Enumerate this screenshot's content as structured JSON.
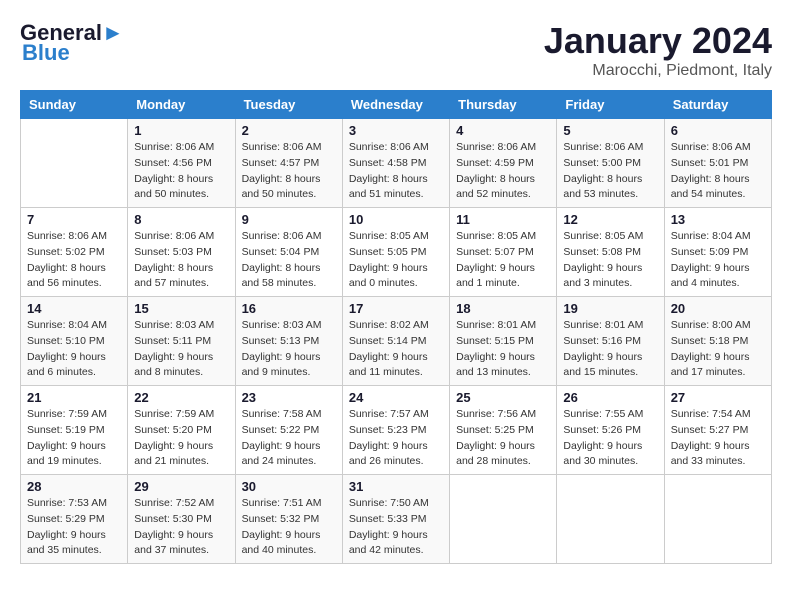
{
  "logo": {
    "line1": "General",
    "line2": "Blue"
  },
  "title": "January 2024",
  "subtitle": "Marocchi, Piedmont, Italy",
  "days_header": [
    "Sunday",
    "Monday",
    "Tuesday",
    "Wednesday",
    "Thursday",
    "Friday",
    "Saturday"
  ],
  "weeks": [
    [
      {
        "num": "",
        "detail": ""
      },
      {
        "num": "1",
        "detail": "Sunrise: 8:06 AM\nSunset: 4:56 PM\nDaylight: 8 hours\nand 50 minutes."
      },
      {
        "num": "2",
        "detail": "Sunrise: 8:06 AM\nSunset: 4:57 PM\nDaylight: 8 hours\nand 50 minutes."
      },
      {
        "num": "3",
        "detail": "Sunrise: 8:06 AM\nSunset: 4:58 PM\nDaylight: 8 hours\nand 51 minutes."
      },
      {
        "num": "4",
        "detail": "Sunrise: 8:06 AM\nSunset: 4:59 PM\nDaylight: 8 hours\nand 52 minutes."
      },
      {
        "num": "5",
        "detail": "Sunrise: 8:06 AM\nSunset: 5:00 PM\nDaylight: 8 hours\nand 53 minutes."
      },
      {
        "num": "6",
        "detail": "Sunrise: 8:06 AM\nSunset: 5:01 PM\nDaylight: 8 hours\nand 54 minutes."
      }
    ],
    [
      {
        "num": "7",
        "detail": "Sunrise: 8:06 AM\nSunset: 5:02 PM\nDaylight: 8 hours\nand 56 minutes."
      },
      {
        "num": "8",
        "detail": "Sunrise: 8:06 AM\nSunset: 5:03 PM\nDaylight: 8 hours\nand 57 minutes."
      },
      {
        "num": "9",
        "detail": "Sunrise: 8:06 AM\nSunset: 5:04 PM\nDaylight: 8 hours\nand 58 minutes."
      },
      {
        "num": "10",
        "detail": "Sunrise: 8:05 AM\nSunset: 5:05 PM\nDaylight: 9 hours\nand 0 minutes."
      },
      {
        "num": "11",
        "detail": "Sunrise: 8:05 AM\nSunset: 5:07 PM\nDaylight: 9 hours\nand 1 minute."
      },
      {
        "num": "12",
        "detail": "Sunrise: 8:05 AM\nSunset: 5:08 PM\nDaylight: 9 hours\nand 3 minutes."
      },
      {
        "num": "13",
        "detail": "Sunrise: 8:04 AM\nSunset: 5:09 PM\nDaylight: 9 hours\nand 4 minutes."
      }
    ],
    [
      {
        "num": "14",
        "detail": "Sunrise: 8:04 AM\nSunset: 5:10 PM\nDaylight: 9 hours\nand 6 minutes."
      },
      {
        "num": "15",
        "detail": "Sunrise: 8:03 AM\nSunset: 5:11 PM\nDaylight: 9 hours\nand 8 minutes."
      },
      {
        "num": "16",
        "detail": "Sunrise: 8:03 AM\nSunset: 5:13 PM\nDaylight: 9 hours\nand 9 minutes."
      },
      {
        "num": "17",
        "detail": "Sunrise: 8:02 AM\nSunset: 5:14 PM\nDaylight: 9 hours\nand 11 minutes."
      },
      {
        "num": "18",
        "detail": "Sunrise: 8:01 AM\nSunset: 5:15 PM\nDaylight: 9 hours\nand 13 minutes."
      },
      {
        "num": "19",
        "detail": "Sunrise: 8:01 AM\nSunset: 5:16 PM\nDaylight: 9 hours\nand 15 minutes."
      },
      {
        "num": "20",
        "detail": "Sunrise: 8:00 AM\nSunset: 5:18 PM\nDaylight: 9 hours\nand 17 minutes."
      }
    ],
    [
      {
        "num": "21",
        "detail": "Sunrise: 7:59 AM\nSunset: 5:19 PM\nDaylight: 9 hours\nand 19 minutes."
      },
      {
        "num": "22",
        "detail": "Sunrise: 7:59 AM\nSunset: 5:20 PM\nDaylight: 9 hours\nand 21 minutes."
      },
      {
        "num": "23",
        "detail": "Sunrise: 7:58 AM\nSunset: 5:22 PM\nDaylight: 9 hours\nand 24 minutes."
      },
      {
        "num": "24",
        "detail": "Sunrise: 7:57 AM\nSunset: 5:23 PM\nDaylight: 9 hours\nand 26 minutes."
      },
      {
        "num": "25",
        "detail": "Sunrise: 7:56 AM\nSunset: 5:25 PM\nDaylight: 9 hours\nand 28 minutes."
      },
      {
        "num": "26",
        "detail": "Sunrise: 7:55 AM\nSunset: 5:26 PM\nDaylight: 9 hours\nand 30 minutes."
      },
      {
        "num": "27",
        "detail": "Sunrise: 7:54 AM\nSunset: 5:27 PM\nDaylight: 9 hours\nand 33 minutes."
      }
    ],
    [
      {
        "num": "28",
        "detail": "Sunrise: 7:53 AM\nSunset: 5:29 PM\nDaylight: 9 hours\nand 35 minutes."
      },
      {
        "num": "29",
        "detail": "Sunrise: 7:52 AM\nSunset: 5:30 PM\nDaylight: 9 hours\nand 37 minutes."
      },
      {
        "num": "30",
        "detail": "Sunrise: 7:51 AM\nSunset: 5:32 PM\nDaylight: 9 hours\nand 40 minutes."
      },
      {
        "num": "31",
        "detail": "Sunrise: 7:50 AM\nSunset: 5:33 PM\nDaylight: 9 hours\nand 42 minutes."
      },
      {
        "num": "",
        "detail": ""
      },
      {
        "num": "",
        "detail": ""
      },
      {
        "num": "",
        "detail": ""
      }
    ]
  ]
}
